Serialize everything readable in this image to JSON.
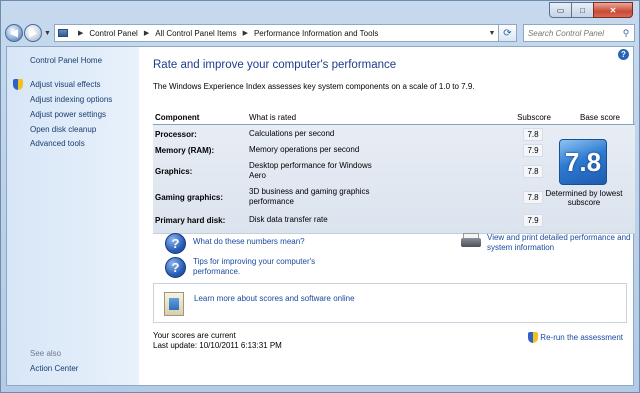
{
  "window": {
    "minimize_glyph": "▭",
    "maximize_glyph": "□",
    "close_glyph": "✕"
  },
  "address_bar": {
    "crumbs": [
      "Control Panel",
      "All Control Panel Items",
      "Performance Information and Tools"
    ]
  },
  "search": {
    "placeholder": "Search Control Panel"
  },
  "sidebar": {
    "home": "Control Panel Home",
    "links": [
      "Adjust visual effects",
      "Adjust indexing options",
      "Adjust power settings",
      "Open disk cleanup",
      "Advanced tools"
    ],
    "see_also_heading": "See also",
    "see_also_links": [
      "Action Center"
    ]
  },
  "main": {
    "title": "Rate and improve your computer's performance",
    "intro": "The Windows Experience Index assesses key system components on a scale of 1.0 to 7.9.",
    "table": {
      "headers": {
        "component": "Component",
        "rated": "What is rated",
        "subscore": "Subscore",
        "base": "Base score"
      },
      "rows": [
        {
          "component": "Processor:",
          "rated": "Calculations per second",
          "subscore": "7.8"
        },
        {
          "component": "Memory (RAM):",
          "rated": "Memory operations per second",
          "subscore": "7.9"
        },
        {
          "component": "Graphics:",
          "rated": "Desktop performance for Windows Aero",
          "subscore": "7.8"
        },
        {
          "component": "Gaming graphics:",
          "rated": "3D business and gaming graphics performance",
          "subscore": "7.8"
        },
        {
          "component": "Primary hard disk:",
          "rated": "Disk data transfer rate",
          "subscore": "7.9"
        }
      ],
      "base_score": "7.8",
      "base_note": "Determined by lowest subscore"
    },
    "links": {
      "numbers": "What do these numbers mean?",
      "tips": "Tips for improving your computer's performance.",
      "print": "View and print detailed performance and system information",
      "learn": "Learn more about scores and software online"
    },
    "status": {
      "current": "Your scores are current",
      "last_update": "Last update: 10/10/2011 6:13:31 PM"
    },
    "rerun": "Re-run the assessment"
  }
}
